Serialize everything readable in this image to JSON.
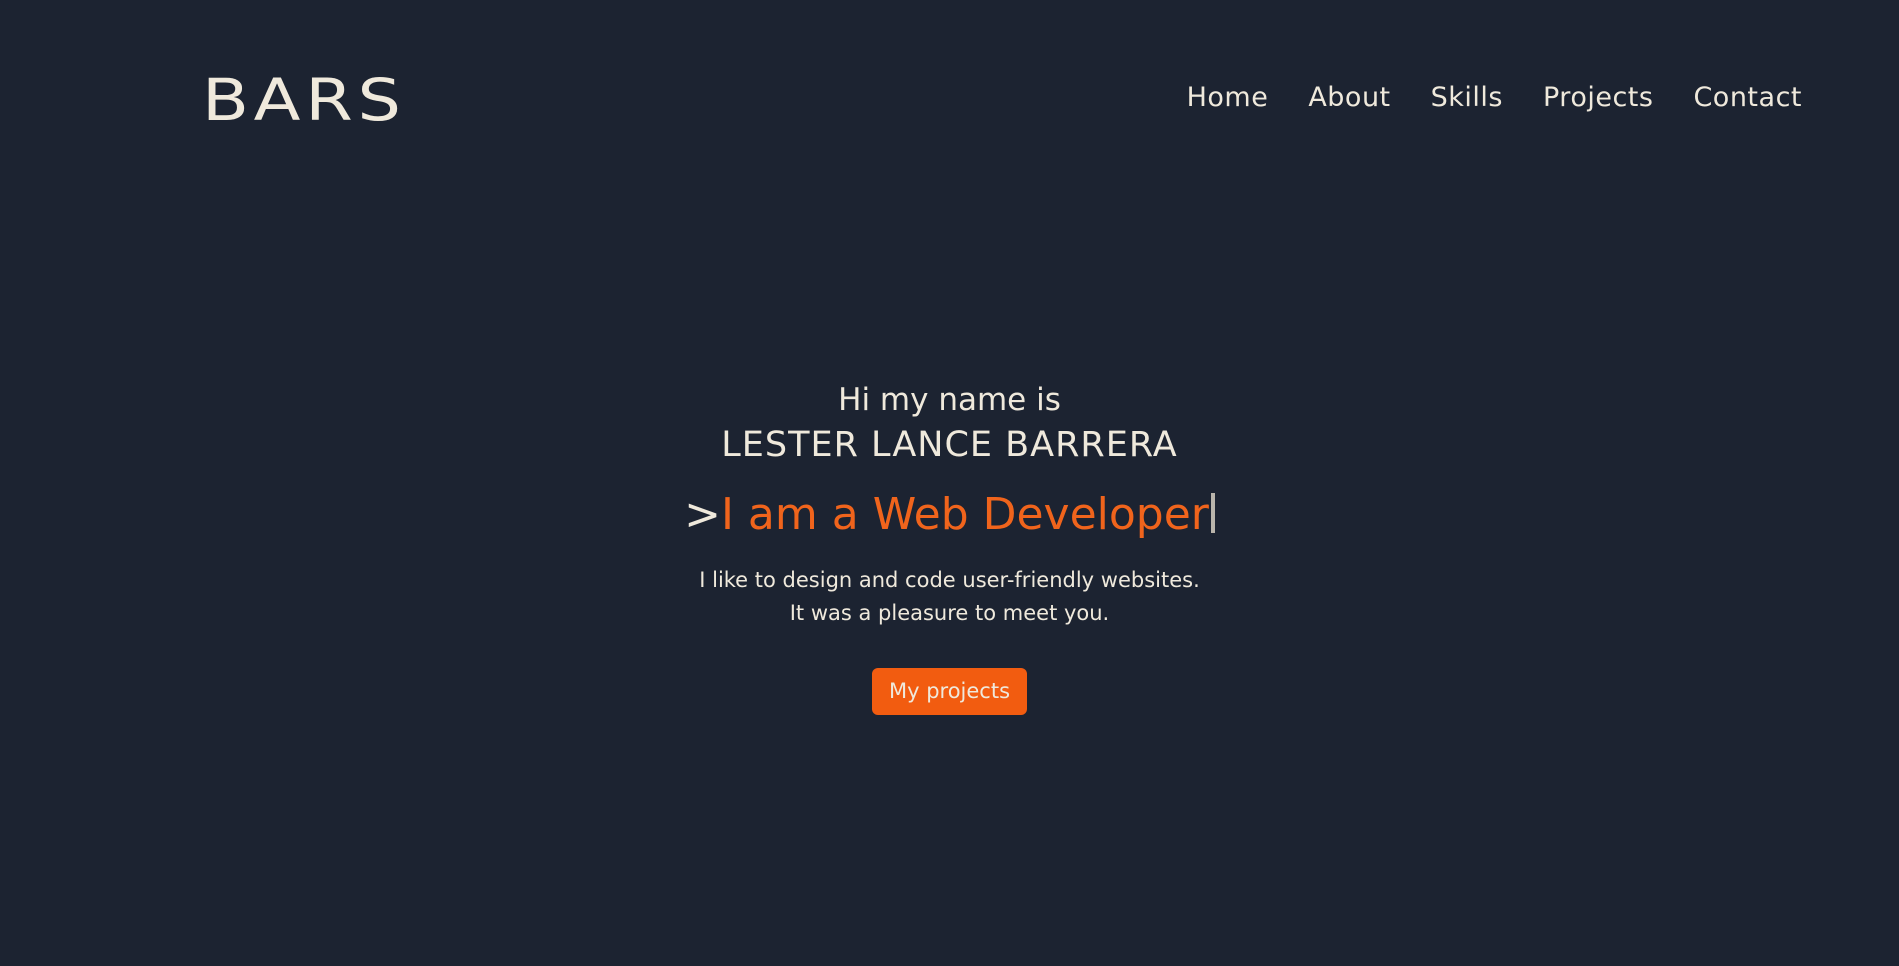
{
  "colors": {
    "background": "#1c2331",
    "text": "#efe9dc",
    "accent": "#f25c10"
  },
  "header": {
    "logo": "BARS",
    "nav": [
      "Home",
      "About",
      "Skills",
      "Projects",
      "Contact"
    ]
  },
  "hero": {
    "greeting": "Hi my name is",
    "name": "LESTER LANCE BARRERA",
    "prompt": ">",
    "role": "I am a Web Developer",
    "tagline_line1": "I like to design and code user-friendly websites.",
    "tagline_line2": "It was a pleasure to meet you.",
    "cta_label": "My projects"
  }
}
